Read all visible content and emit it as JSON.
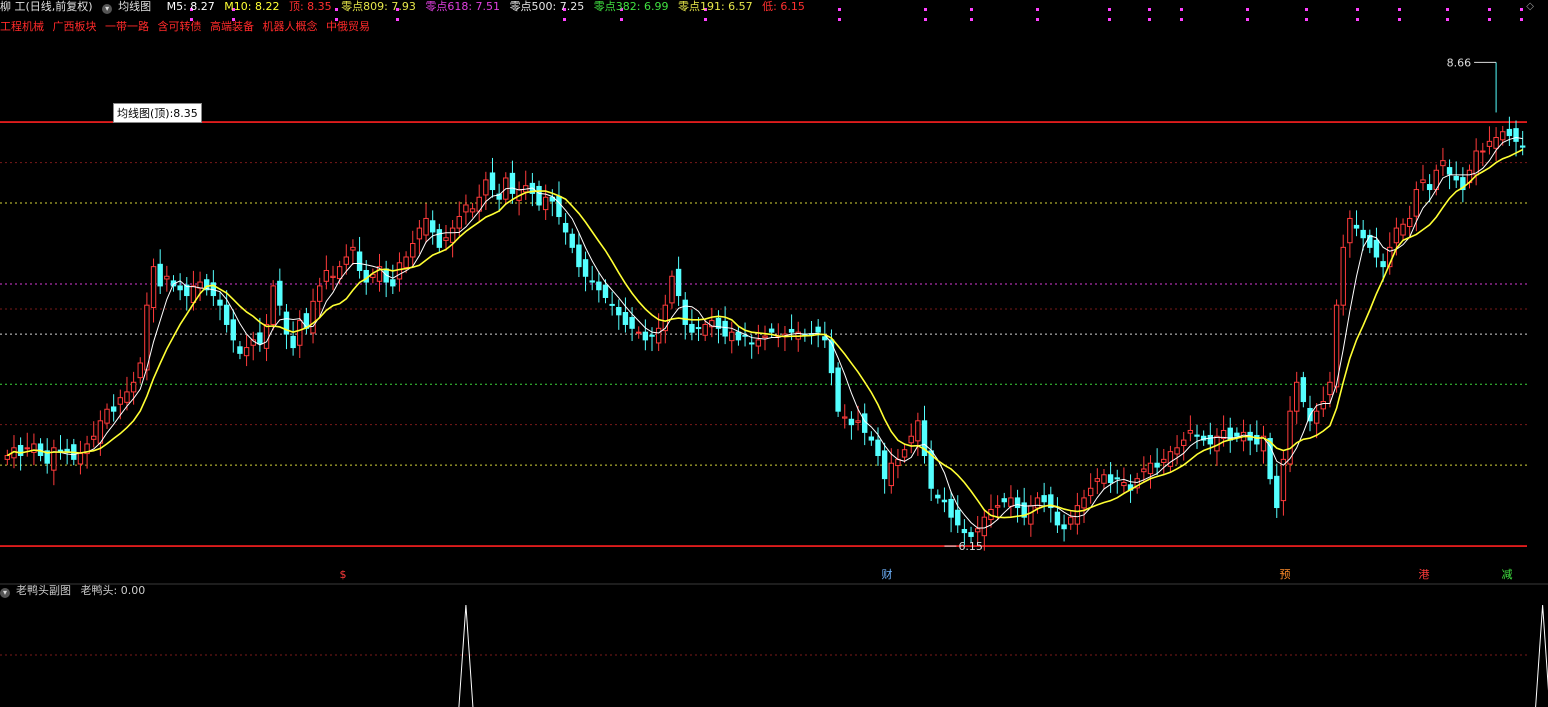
{
  "header": {
    "stock": "柳 工(日线,前复权)",
    "indicator": "均线图",
    "ma5_label": "M5: 8.27",
    "ma10_label": "M10: 8.22",
    "top_label": "顶: 8.35",
    "z809_label": "零点809: 7.93",
    "z618_label": "零点618: 7.51",
    "z500_label": "零点500: 7.25",
    "z382_label": "零点382: 6.99",
    "z191_label": "零点191: 6.57",
    "low_label": "低: 6.15"
  },
  "tags": [
    "工程机械",
    "广西板块",
    "一带一路",
    "含可转债",
    "高端装备",
    "机器人概念",
    "中俄贸易"
  ],
  "tooltip": "均线图(顶):8.35",
  "sub_panel": {
    "title": "老鸭头副图",
    "value_label": "老鸭头: 0.00"
  },
  "colors": {
    "up": "#ff3b3b",
    "down": "#54ffff",
    "ma5": "#ffffff",
    "ma10": "#ffff33",
    "background": "#000000"
  },
  "chart_data": {
    "type": "candlestick",
    "ylim": [
      6.0,
      8.75
    ],
    "high_label": "8.66",
    "low_label": "6.15",
    "markers": [
      "$",
      "财",
      "预",
      "港",
      "减"
    ],
    "levels": [
      {
        "name": "顶",
        "value": 8.35,
        "color": "#ff2020"
      },
      {
        "name": "零点809",
        "value": 7.93,
        "color": "#d4d43a"
      },
      {
        "name": "零点618",
        "value": 7.51,
        "color": "#d43ad4"
      },
      {
        "name": "零点500",
        "value": 7.25,
        "color": "#d4d4d4"
      },
      {
        "name": "零点382",
        "value": 6.99,
        "color": "#3ad43a"
      },
      {
        "name": "零点191",
        "value": 6.57,
        "color": "#d4d43a"
      },
      {
        "name": "低",
        "value": 6.15,
        "color": "#ff2020"
      }
    ],
    "closes": [
      6.62,
      6.66,
      6.62,
      6.66,
      6.68,
      6.62,
      6.58,
      6.66,
      6.64,
      6.64,
      6.6,
      6.63,
      6.68,
      6.72,
      6.8,
      6.86,
      6.85,
      6.92,
      6.95,
      7.0,
      7.1,
      7.4,
      7.6,
      7.5,
      7.55,
      7.5,
      7.48,
      7.45,
      7.5,
      7.52,
      7.48,
      7.45,
      7.4,
      7.3,
      7.22,
      7.15,
      7.18,
      7.22,
      7.2,
      7.3,
      7.5,
      7.4,
      7.25,
      7.18,
      7.32,
      7.28,
      7.42,
      7.5,
      7.58,
      7.55,
      7.6,
      7.65,
      7.7,
      7.58,
      7.52,
      7.56,
      7.6,
      7.52,
      7.5,
      7.62,
      7.65,
      7.72,
      7.8,
      7.85,
      7.78,
      7.7,
      7.75,
      7.8,
      7.86,
      7.92,
      7.9,
      7.96,
      8.05,
      8.0,
      7.95,
      8.06,
      7.98,
      8.0,
      8.02,
      7.98,
      7.92,
      7.96,
      7.94,
      7.86,
      7.78,
      7.7,
      7.6,
      7.55,
      7.52,
      7.48,
      7.44,
      7.4,
      7.35,
      7.3,
      7.28,
      7.26,
      7.22,
      7.24,
      7.28,
      7.4,
      7.55,
      7.45,
      7.3,
      7.26,
      7.28,
      7.3,
      7.32,
      7.28,
      7.24,
      7.26,
      7.22,
      7.24,
      7.2,
      7.22,
      7.24,
      7.26,
      7.24,
      7.25,
      7.26,
      7.26,
      7.24,
      7.25,
      7.26,
      7.22,
      7.05,
      6.85,
      6.82,
      6.78,
      6.8,
      6.74,
      6.7,
      6.62,
      6.5,
      6.58,
      6.6,
      6.65,
      6.72,
      6.8,
      6.62,
      6.45,
      6.4,
      6.38,
      6.3,
      6.26,
      6.22,
      6.2,
      6.24,
      6.3,
      6.34,
      6.36,
      6.38,
      6.4,
      6.35,
      6.3,
      6.36,
      6.4,
      6.38,
      6.35,
      6.26,
      6.24,
      6.3,
      6.36,
      6.4,
      6.45,
      6.5,
      6.52,
      6.48,
      6.5,
      6.48,
      6.44,
      6.5,
      6.55,
      6.58,
      6.56,
      6.6,
      6.64,
      6.66,
      6.7,
      6.75,
      6.72,
      6.7,
      6.68,
      6.72,
      6.75,
      6.7,
      6.72,
      6.74,
      6.7,
      6.68,
      6.72,
      6.5,
      6.35,
      6.6,
      6.85,
      7.0,
      6.9,
      6.8,
      6.85,
      6.9,
      7.0,
      7.4,
      7.7,
      7.85,
      7.8,
      7.75,
      7.7,
      7.65,
      7.6,
      7.7,
      7.8,
      7.82,
      7.85,
      8.0,
      8.05,
      8.0,
      8.1,
      8.15,
      8.08,
      8.05,
      8.0,
      8.1,
      8.2,
      8.2,
      8.25,
      8.27,
      8.3,
      8.28,
      8.25,
      8.22
    ],
    "volume_peaks": [
      {
        "index": 69,
        "value": 1
      },
      {
        "index": 231,
        "value": 1
      }
    ]
  }
}
